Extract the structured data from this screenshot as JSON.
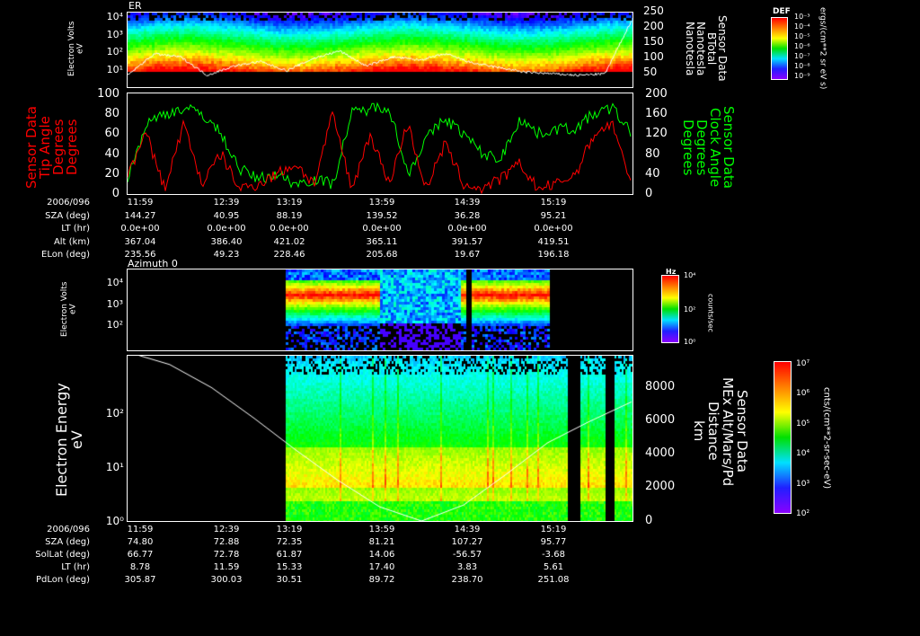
{
  "panel1": {
    "title": "ER",
    "ylabel": "Electron Volts",
    "yunit": "eV",
    "yticks": [
      "10⁴",
      "10³",
      "10²",
      "10¹"
    ],
    "rticks": [
      "250",
      "200",
      "150",
      "100",
      "50"
    ],
    "rlabel": [
      "Sensor Data",
      "BTotal",
      "Nanotesla",
      "Nanotesla"
    ],
    "cbar_title": "DEF",
    "cbar_ticks": [
      "10⁻³",
      "10⁻⁴",
      "10⁻⁵",
      "10⁻⁶",
      "10⁻⁷",
      "10⁻⁸",
      "10⁻⁹"
    ],
    "cbar_unit": "ergs/(cm**2 sr eV s)"
  },
  "panel2": {
    "llabel": [
      "Sensor Data",
      "Tip Angle",
      "Degrees",
      "Degrees"
    ],
    "lticks": [
      "100",
      "80",
      "60",
      "40",
      "20",
      "0"
    ],
    "rlabel": [
      "Sensor Data",
      "Clock Angle",
      "Degrees",
      "Degrees"
    ],
    "rticks": [
      "200",
      "160",
      "120",
      "80",
      "40",
      "0"
    ],
    "colors": {
      "tip": "#ff0000",
      "clock": "#00ff00"
    }
  },
  "table1": {
    "rows": [
      {
        "label": "2006/096",
        "values": [
          "11:59",
          "12:39",
          "13:19",
          "13:59",
          "14:39",
          "15:19"
        ]
      },
      {
        "label": "SZA (deg)",
        "values": [
          "144.27",
          "40.95",
          "88.19",
          "139.52",
          "36.28",
          "95.21"
        ]
      },
      {
        "label": "LT (hr)",
        "values": [
          "0.0e+00",
          "0.0e+00",
          "0.0e+00",
          "0.0e+00",
          "0.0e+00",
          "0.0e+00"
        ]
      },
      {
        "label": "Alt (km)",
        "values": [
          "367.04",
          "386.40",
          "421.02",
          "365.11",
          "391.57",
          "419.51"
        ]
      },
      {
        "label": "ELon (deg)",
        "values": [
          "235.56",
          "49.23",
          "228.46",
          "205.68",
          "19.67",
          "196.18"
        ]
      }
    ]
  },
  "panel3": {
    "title": "Azimuth 0",
    "ylabel": "Electron Volts",
    "yunit": "eV",
    "yticks": [
      "10⁴",
      "10³",
      "10²"
    ],
    "cbar_title": "Hz",
    "cbar_ticks": [
      "10⁴",
      "10²",
      "10⁰"
    ],
    "cbar_unit": "counts/sec"
  },
  "panel4": {
    "ylabel": "Electron Energy",
    "yunit": "eV",
    "yticks": [
      "10²",
      "10¹",
      "10⁰"
    ],
    "rticks": [
      "8000",
      "6000",
      "4000",
      "2000",
      "0"
    ],
    "rlabel": [
      "Sensor Data",
      "MEx Alt/Mars/Pd",
      "Distance",
      "km"
    ],
    "cbar_ticks": [
      "10⁷",
      "10⁶",
      "10⁵",
      "10⁴",
      "10³",
      "10²"
    ],
    "cbar_unit": "cnts/(cm**2-sr-sec-eV)"
  },
  "table2": {
    "rows": [
      {
        "label": "2006/096",
        "values": [
          "11:59",
          "12:39",
          "13:19",
          "13:59",
          "14:39",
          "15:19"
        ]
      },
      {
        "label": "SZA (deg)",
        "values": [
          "74.80",
          "72.88",
          "72.35",
          "81.21",
          "107.27",
          "95.77"
        ]
      },
      {
        "label": "SolLat (deg)",
        "values": [
          "66.77",
          "72.78",
          "61.87",
          "14.06",
          "-56.57",
          "-3.68"
        ]
      },
      {
        "label": "LT (hr)",
        "values": [
          "8.78",
          "11.59",
          "15.33",
          "17.40",
          "3.83",
          "5.61"
        ]
      },
      {
        "label": "PdLon (deg)",
        "values": [
          "305.87",
          "300.03",
          "30.51",
          "89.72",
          "238.70",
          "251.08"
        ]
      }
    ]
  },
  "chart_data": [
    {
      "type": "heatmap",
      "title": "ER",
      "ylabel": "Electron Volts (eV)",
      "ylim": [
        10,
        20000
      ],
      "x": [
        "11:59",
        "12:39",
        "13:19",
        "13:59",
        "14:39",
        "15:19"
      ],
      "overlay": {
        "name": "BTotal (Nanotesla)",
        "ylim": [
          0,
          250
        ],
        "values": [
          30,
          100,
          90,
          30,
          60,
          75,
          45,
          85,
          110,
          60,
          90,
          80,
          100,
          70,
          55,
          40,
          35,
          30,
          35,
          210
        ]
      }
    },
    {
      "type": "line",
      "x": [
        "11:59",
        "12:39",
        "13:19",
        "13:59",
        "14:39",
        "15:19"
      ],
      "series": [
        {
          "name": "Tip Angle (Degrees)",
          "ylim": [
            0,
            100
          ],
          "values": [
            20,
            60,
            5,
            70,
            10,
            40,
            5,
            10,
            20,
            30,
            10,
            80,
            5,
            60,
            10,
            70,
            5,
            50,
            10,
            5,
            15,
            30,
            5,
            10,
            20,
            60,
            70,
            5
          ]
        },
        {
          "name": "Clock Angle (Degrees)",
          "ylim": [
            0,
            200
          ],
          "values": [
            30,
            140,
            160,
            170,
            160,
            120,
            50,
            30,
            40,
            20,
            30,
            20,
            160,
            170,
            175,
            40,
            110,
            150,
            120,
            80,
            70,
            150,
            120,
            130,
            130,
            160,
            170,
            120
          ]
        }
      ]
    },
    {
      "type": "heatmap",
      "title": "Azimuth 0",
      "ylabel": "Electron Volts (eV)",
      "ylim": [
        10,
        20000
      ],
      "colorbar": "counts/sec"
    },
    {
      "type": "heatmap",
      "ylabel": "Electron Energy (eV)",
      "ylim": [
        1,
        1000
      ],
      "overlay": {
        "name": "MEx Alt/Mars/Pd Distance (km)",
        "ylim": [
          0,
          10000
        ],
        "values": [
          9500,
          8800,
          7500,
          5800,
          4000,
          2300,
          800,
          0,
          900,
          2600,
          4400,
          5600,
          6700
        ]
      }
    }
  ]
}
